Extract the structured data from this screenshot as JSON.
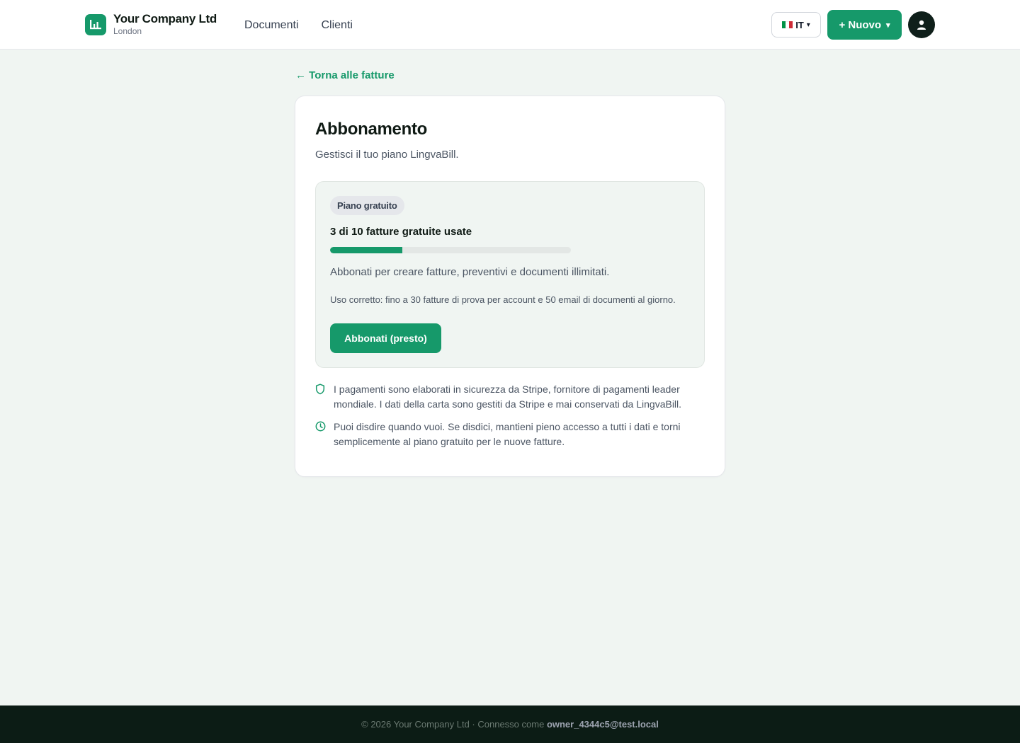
{
  "header": {
    "company_name": "Your Company Ltd",
    "company_city": "London",
    "nav": [
      {
        "label": "Documenti"
      },
      {
        "label": "Clienti"
      }
    ],
    "language": "IT",
    "language_caret": "▾",
    "new_button": "+ Nuovo",
    "new_caret": "▾"
  },
  "back_link": "← Torna alle fatture",
  "card": {
    "title": "Abbonamento",
    "subtitle": "Gestisci il tuo piano LingvaBill.",
    "plan": {
      "badge": "Piano gratuito",
      "usage_text": "3 di 10 fatture gratuite usate",
      "used": 3,
      "limit": 10,
      "description": "Abbonati per creare fatture, preventivi e documenti illimitati.",
      "fair_use": "Uso corretto: fino a 30 fatture di prova per account e 50 email di documenti al giorno.",
      "subscribe_button": "Abbonati (presto)"
    },
    "info": [
      {
        "icon": "shield-icon",
        "text": "I pagamenti sono elaborati in sicurezza da Stripe, fornitore di pagamenti leader mondiale. I dati della carta sono gestiti da Stripe e mai conservati da LingvaBill."
      },
      {
        "icon": "clock-icon",
        "text": "Puoi disdire quando vuoi. Se disdici, mantieni pieno accesso a tutti i dati e torni semplicemente al piano gratuito per le nuove fatture."
      }
    ]
  },
  "footer": {
    "prefix": "© 2026 Your Company Ltd · Connesso come",
    "email": "owner_4344c5@test.local"
  },
  "colors": {
    "accent": "#16996a",
    "background": "#f0f5f2",
    "footer": "#0c1c15"
  }
}
